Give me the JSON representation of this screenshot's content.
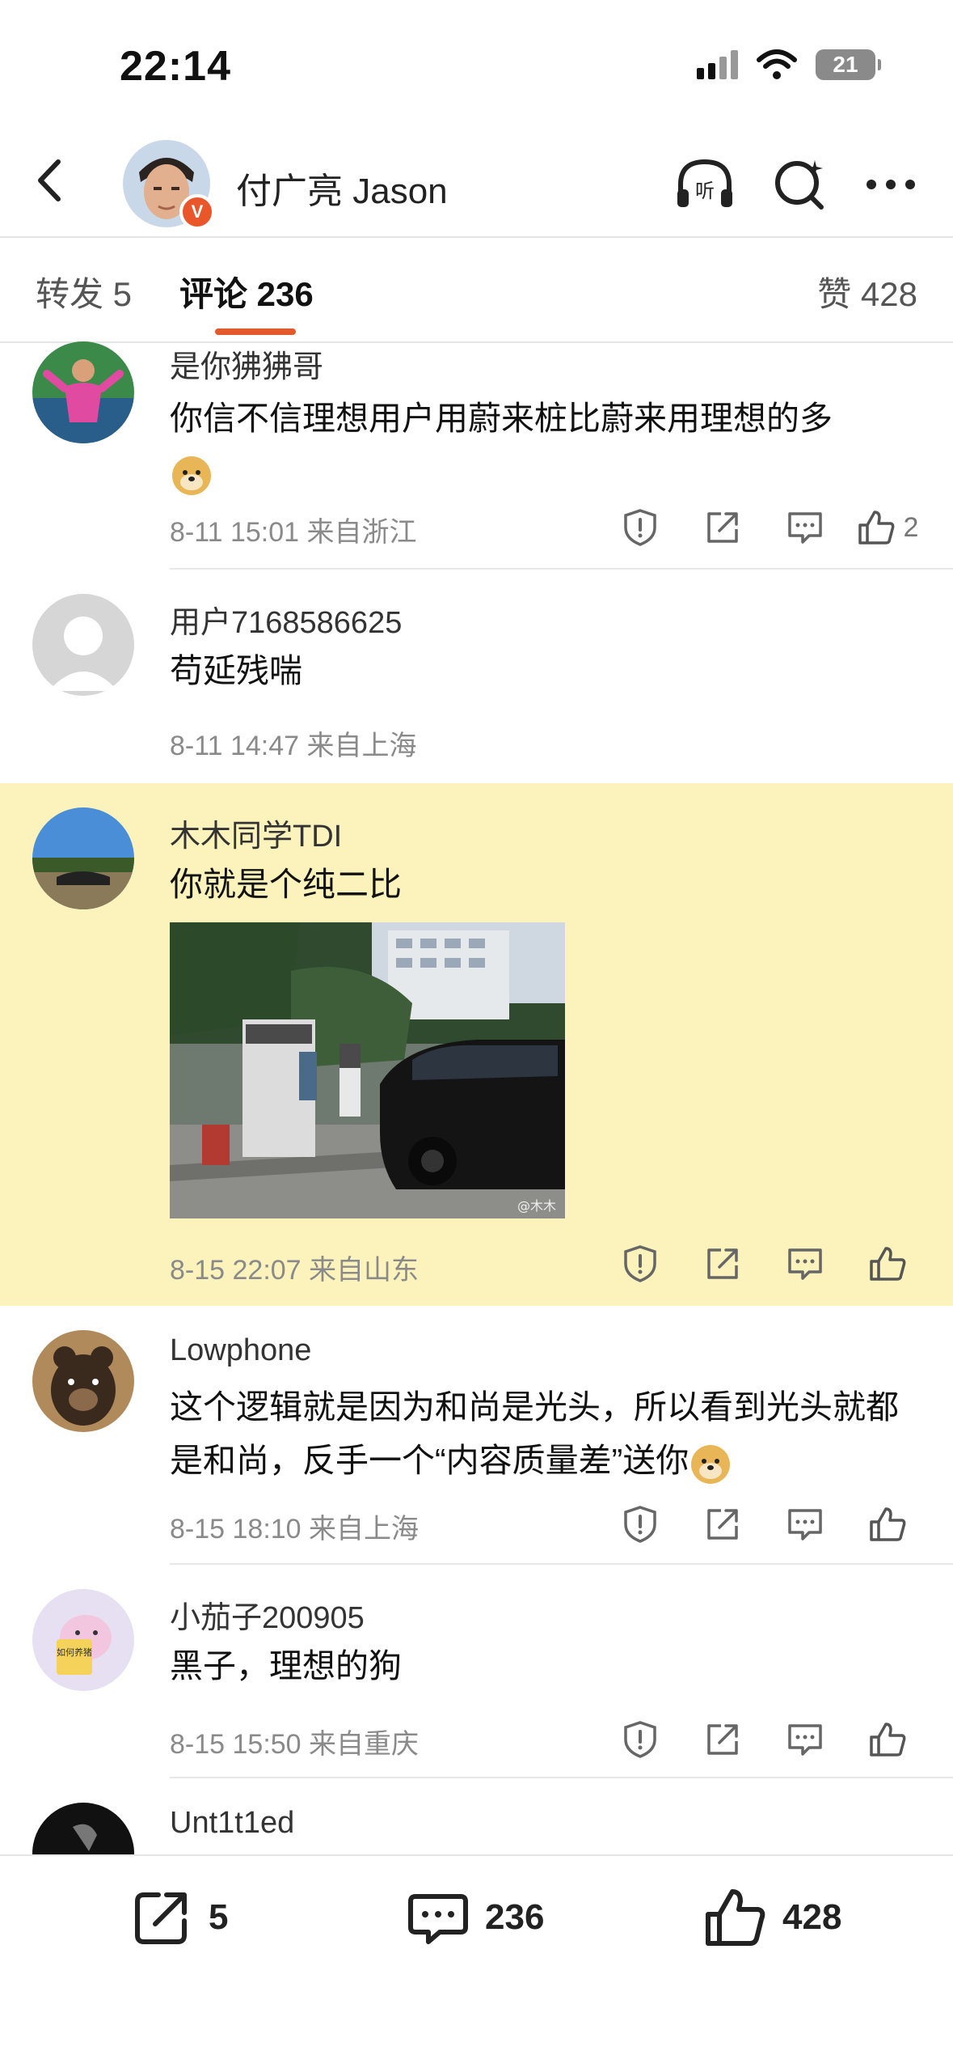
{
  "status": {
    "time": "22:14",
    "battery": "21"
  },
  "header": {
    "user_name": "付广亮 Jason",
    "verified_mark": "V",
    "listen_label": "听"
  },
  "tabs": {
    "repost": "转发 5",
    "comments": "评论 236",
    "likes": "赞 428"
  },
  "comments": [
    {
      "name": "是你狒狒哥",
      "text": "你信不信理想用户用蔚来桩比蔚来用理想的多",
      "meta": "8-11 15:01 来自浙江",
      "likes": "2"
    },
    {
      "name": "用户7168586625",
      "text": "苟延残喘",
      "meta": "8-11 14:47 来自上海"
    },
    {
      "name": "木木同学TDI",
      "text": "你就是个纯二比",
      "meta": "8-15 22:07 来自山东",
      "image_watermark": "@木木"
    },
    {
      "name": "Lowphone",
      "text": "这个逻辑就是因为和尚是光头，所以看到光头就都是和尚，反手一个“内容质量差”送你",
      "meta": "8-15 18:10 来自上海"
    },
    {
      "name": "小茄子200905",
      "text": "黑子，理想的狗",
      "meta": "8-15 15:50 来自重庆",
      "avatar_text": "如何养猪"
    },
    {
      "name": "Unt1t1ed"
    }
  ],
  "bottom_bar": {
    "repost_count": "5",
    "comment_count": "236",
    "like_count": "428"
  },
  "colors": {
    "accent": "#e4592b",
    "highlight": "#fcf3bc",
    "meta_gray": "#8a8a8a"
  }
}
